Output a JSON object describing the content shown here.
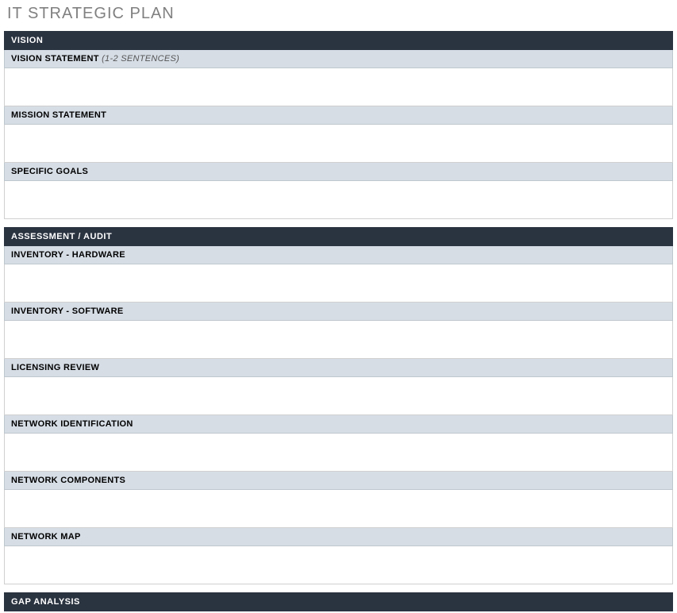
{
  "title": "IT STRATEGIC PLAN",
  "sections": {
    "vision": {
      "header": "VISION",
      "vision_statement_label": "VISION STATEMENT",
      "vision_statement_hint": "(1-2 SENTENCES)",
      "mission_statement_label": "MISSION STATEMENT",
      "specific_goals_label": "SPECIFIC GOALS"
    },
    "assessment": {
      "header": "ASSESSMENT / AUDIT",
      "inventory_hardware_label": "INVENTORY - HARDWARE",
      "inventory_software_label": "INVENTORY - SOFTWARE",
      "licensing_review_label": "LICENSING REVIEW",
      "network_identification_label": "NETWORK IDENTIFICATION",
      "network_components_label": "NETWORK COMPONENTS",
      "network_map_label": "NETWORK MAP"
    },
    "gap": {
      "header": "GAP ANALYSIS"
    }
  }
}
